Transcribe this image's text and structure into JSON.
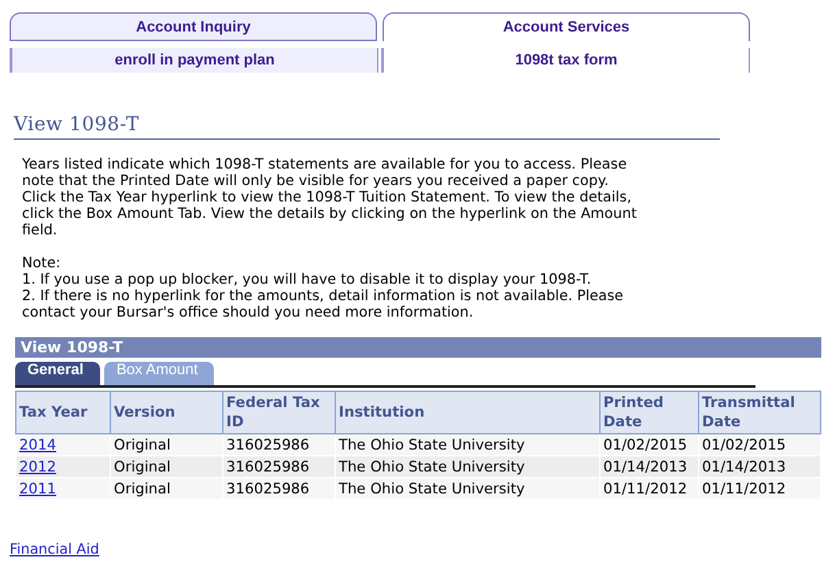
{
  "top_tabs": [
    {
      "label": "Account Inquiry",
      "selected": false
    },
    {
      "label": "Account Services",
      "selected": true
    }
  ],
  "sub_tabs": [
    {
      "label": "enroll in payment plan",
      "selected": false
    },
    {
      "label": "1098t tax form",
      "selected": true
    }
  ],
  "page_title": "View 1098-T",
  "intro": [
    "Years listed indicate which 1098-T statements are available for you to access.  Please",
    "note that the Printed Date will only be visible for years you received a paper copy.",
    "Click the Tax Year hyperlink to view the 1098-T Tuition Statement.  To view the details,",
    "click the Box Amount Tab.  View the details by clicking on the hyperlink on the Amount",
    "field."
  ],
  "note": [
    "Note:",
    "1.  If you use a pop up blocker, you will have to disable it to display your 1098-T.",
    "2.  If there is no hyperlink for the amounts, detail information is not available.  Please",
    "contact your Bursar's office should you need more information."
  ],
  "grid": {
    "title": "View 1098-T",
    "tabs": [
      {
        "label": "General",
        "selected": true
      },
      {
        "label": "Box Amount",
        "selected": false
      }
    ],
    "columns": [
      "Tax Year",
      "Version",
      "Federal Tax ID",
      "Institution",
      "Printed Date",
      "Transmittal Date"
    ],
    "rows": [
      [
        "2014",
        "Original",
        "316025986",
        "The Ohio State University",
        "01/02/2015",
        "01/02/2015"
      ],
      [
        "2012",
        "Original",
        "316025986",
        "The Ohio State University",
        "01/14/2013",
        "01/14/2013"
      ],
      [
        "2011",
        "Original",
        "316025986",
        "The Ohio State University",
        "01/11/2012",
        "01/11/2012"
      ]
    ]
  },
  "footer_link": "Financial Aid"
}
